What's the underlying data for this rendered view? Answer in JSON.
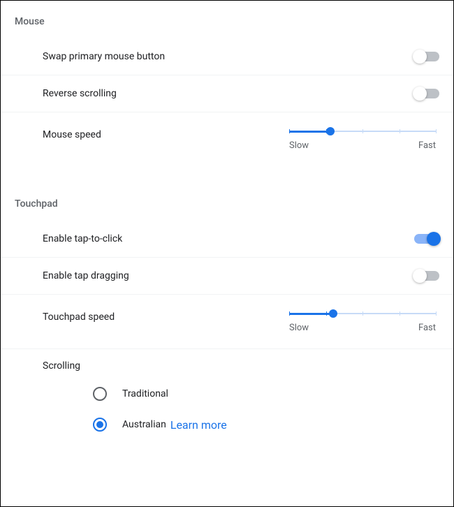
{
  "mouse": {
    "header": "Mouse",
    "swap": {
      "label": "Swap primary mouse button",
      "on": false
    },
    "reverse": {
      "label": "Reverse scrolling",
      "on": false
    },
    "speed": {
      "label": "Mouse speed",
      "slow": "Slow",
      "fast": "Fast",
      "value_percent": 28
    }
  },
  "touchpad": {
    "header": "Touchpad",
    "tap_click": {
      "label": "Enable tap-to-click",
      "on": true
    },
    "tap_drag": {
      "label": "Enable tap dragging",
      "on": false
    },
    "speed": {
      "label": "Touchpad speed",
      "slow": "Slow",
      "fast": "Fast",
      "value_percent": 30
    },
    "scrolling": {
      "label": "Scrolling",
      "options": {
        "traditional": {
          "label": "Traditional",
          "selected": false
        },
        "australian": {
          "label": "Australian",
          "selected": true,
          "link": "Learn more"
        }
      }
    }
  }
}
